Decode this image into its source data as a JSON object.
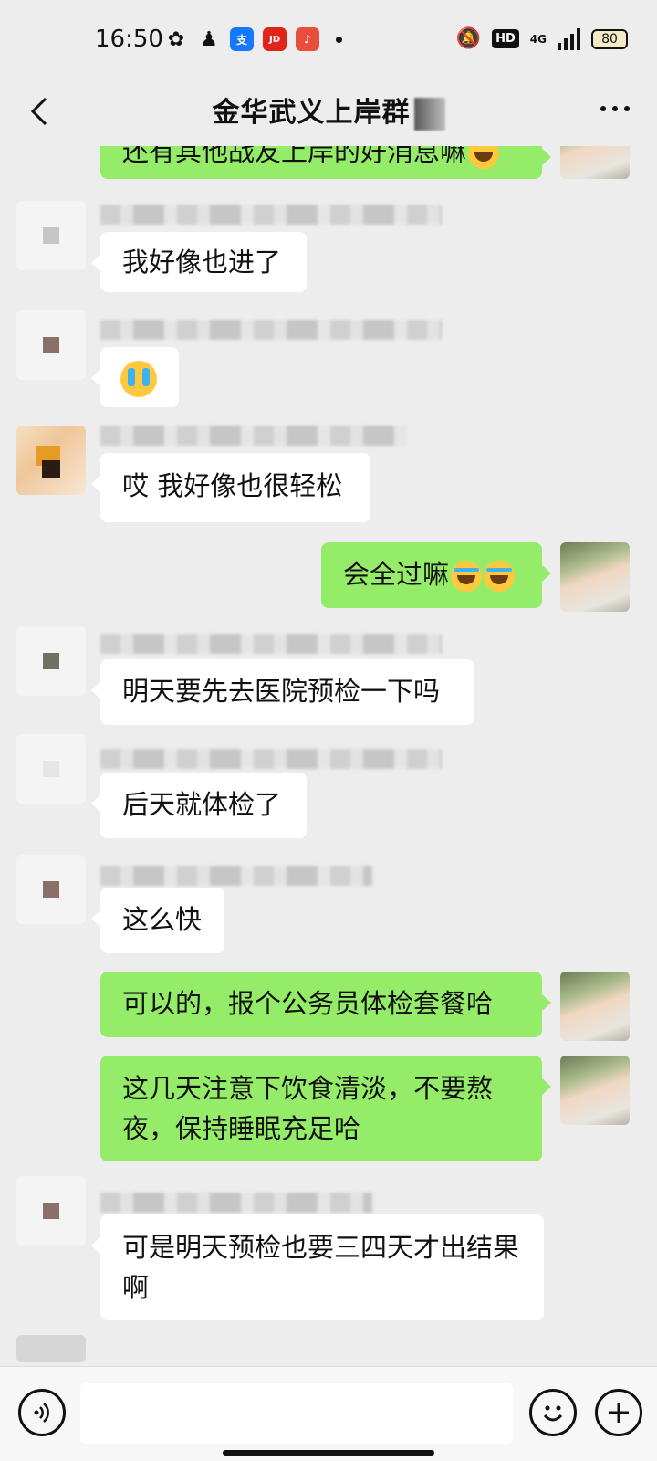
{
  "status_bar": {
    "time": "16:50",
    "battery": "80",
    "hd": "HD",
    "network": "4G"
  },
  "nav": {
    "title": "金华武义上岸群"
  },
  "messages": [
    {
      "side": "right",
      "text": "还有其他战友上岸的好消息嘛"
    },
    {
      "side": "left",
      "text": "我好像也进了"
    },
    {
      "side": "left",
      "text": ""
    },
    {
      "side": "left",
      "text": "哎 我好像也很轻松"
    },
    {
      "side": "right",
      "text": "会全过嘛"
    },
    {
      "side": "left",
      "text": "明天要先去医院预检一下吗"
    },
    {
      "side": "left",
      "text": "后天就体检了"
    },
    {
      "side": "left",
      "text": "这么快"
    },
    {
      "side": "right",
      "text": "可以的，报个公务员体检套餐哈"
    },
    {
      "side": "right",
      "text": "这几天注意下饮食清淡，不要熬夜，保持睡眠充足哈"
    },
    {
      "side": "left",
      "text": "可是明天预检也要三四天才出结果啊"
    }
  ],
  "input": {
    "placeholder": ""
  },
  "colors": {
    "background": "#ededed",
    "bubble_self": "#95ec69",
    "bubble_other": "#ffffff"
  }
}
